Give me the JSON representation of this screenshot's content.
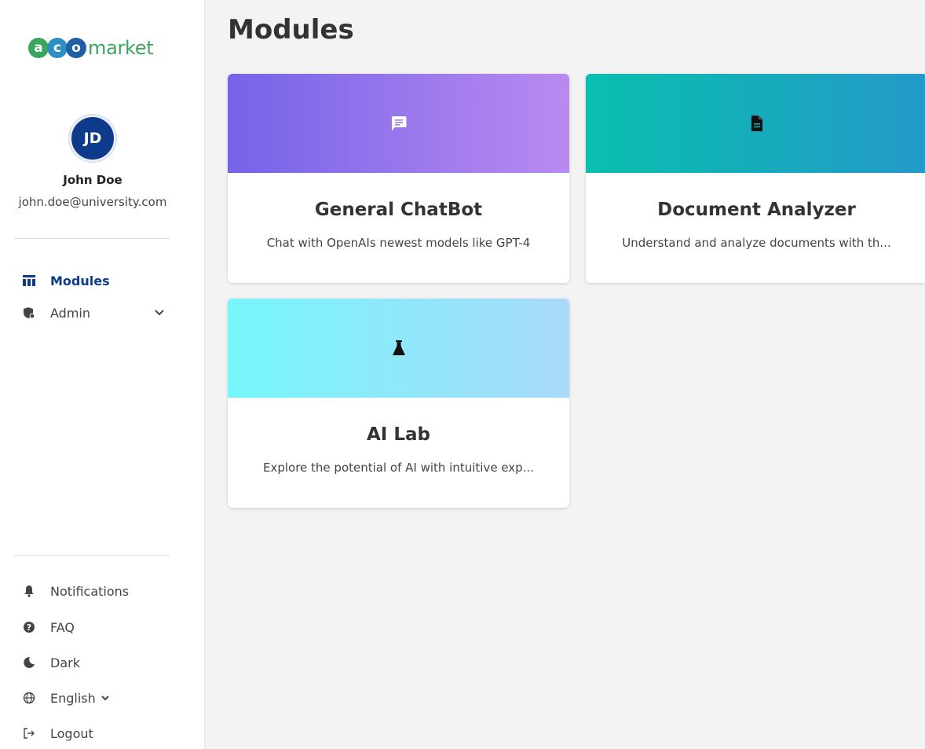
{
  "logo": {
    "letters": [
      "a",
      "c",
      "o"
    ],
    "word": "market",
    "colors": [
      "#3aa55d",
      "#2e8fc4",
      "#1f5fa8"
    ]
  },
  "user": {
    "initials": "JD",
    "name": "John Doe",
    "email": "john.doe@university.com"
  },
  "nav": [
    {
      "label": "Modules",
      "icon": "modules-icon",
      "active": true
    },
    {
      "label": "Admin",
      "icon": "admin-icon",
      "active": false
    }
  ],
  "bottom_nav": [
    {
      "label": "Notifications",
      "icon": "bell-icon"
    },
    {
      "label": "FAQ",
      "icon": "question-icon"
    },
    {
      "label": "Dark",
      "icon": "moon-icon"
    },
    {
      "label": "English",
      "icon": "globe-icon"
    },
    {
      "label": "Logout",
      "icon": "logout-icon"
    }
  ],
  "page_title": "Modules",
  "modules": [
    {
      "title": "General ChatBot",
      "description": "Chat with OpenAIs newest models like GPT-4",
      "icon": "chat-icon",
      "gradient": [
        "#7563e8",
        "#b98af0"
      ]
    },
    {
      "title": "Document Analyzer",
      "description": "Understand and analyze documents with th...",
      "icon": "document-icon",
      "gradient": [
        "#08bfae",
        "#2499c9"
      ]
    },
    {
      "title": "AI Lab",
      "description": "Explore the potential of AI with intuitive exp...",
      "icon": "flask-icon",
      "gradient": [
        "#76f6fb",
        "#a8daf9"
      ]
    }
  ]
}
